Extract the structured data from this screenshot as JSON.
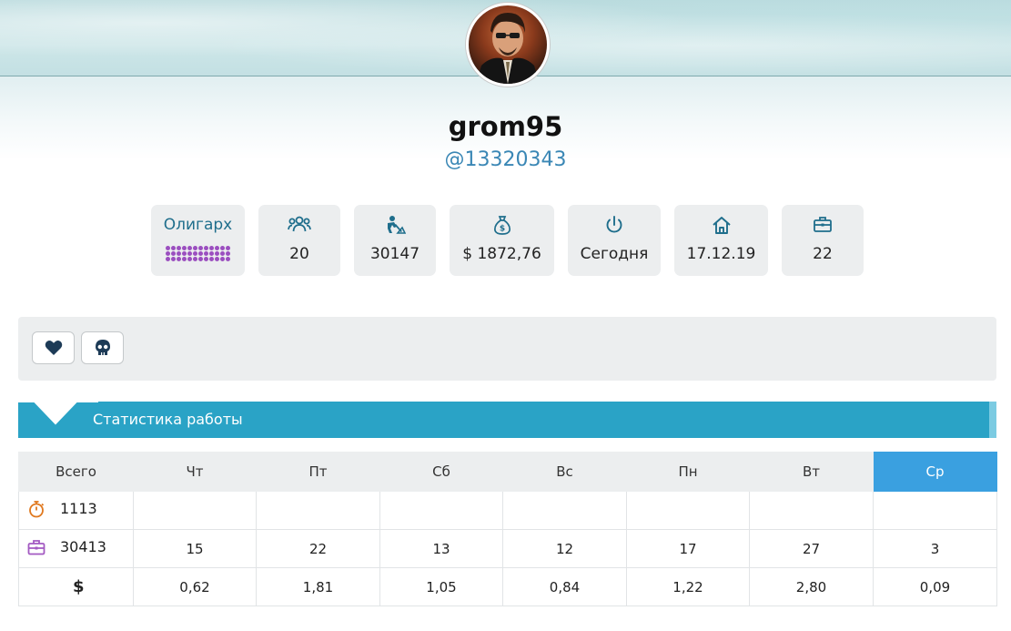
{
  "profile": {
    "username": "grom95",
    "user_id": "@13320343"
  },
  "stats": [
    {
      "kind": "rank",
      "title": "Олигарх",
      "icon": "rank-dots"
    },
    {
      "kind": "friends",
      "value": "20",
      "icon": "users-icon"
    },
    {
      "kind": "workers",
      "value": "30147",
      "icon": "digger-icon"
    },
    {
      "kind": "money",
      "value": "$ 1872,76",
      "icon": "money-bag-icon"
    },
    {
      "kind": "online",
      "value": "Сегодня",
      "icon": "power-icon"
    },
    {
      "kind": "registered",
      "value": "17.12.19",
      "icon": "home-icon"
    },
    {
      "kind": "jobs",
      "value": "22",
      "icon": "briefcase-icon"
    }
  ],
  "actions": {
    "like_icon": "heart-icon",
    "attack_icon": "skull-icon"
  },
  "section": {
    "title": "Статистика работы"
  },
  "work_table": {
    "headers": [
      "Всего",
      "Чт",
      "Пт",
      "Сб",
      "Вс",
      "Пн",
      "Вт",
      "Ср"
    ],
    "highlighted_day": "Ср",
    "rows": [
      {
        "icon": "stopwatch-icon",
        "total": "1113",
        "cells": [
          "",
          "",
          "",
          "",
          "",
          "",
          ""
        ]
      },
      {
        "icon": "briefcase-icon",
        "total": "30413",
        "cells": [
          "15",
          "22",
          "13",
          "12",
          "17",
          "27",
          "3"
        ]
      },
      {
        "icon": "dollar-icon",
        "total": "$",
        "cells": [
          "0,62",
          "1,81",
          "1,05",
          "0,84",
          "1,22",
          "2,80",
          "0,09"
        ]
      }
    ]
  },
  "colors": {
    "accent": "#2aa3c6",
    "today": "#3aa0e0",
    "icon": "#1f6e8c",
    "rank_dots": "#9b4fc0",
    "stopwatch": "#e0781e",
    "briefcase_row": "#a35ac2",
    "link": "#3a87b5"
  }
}
